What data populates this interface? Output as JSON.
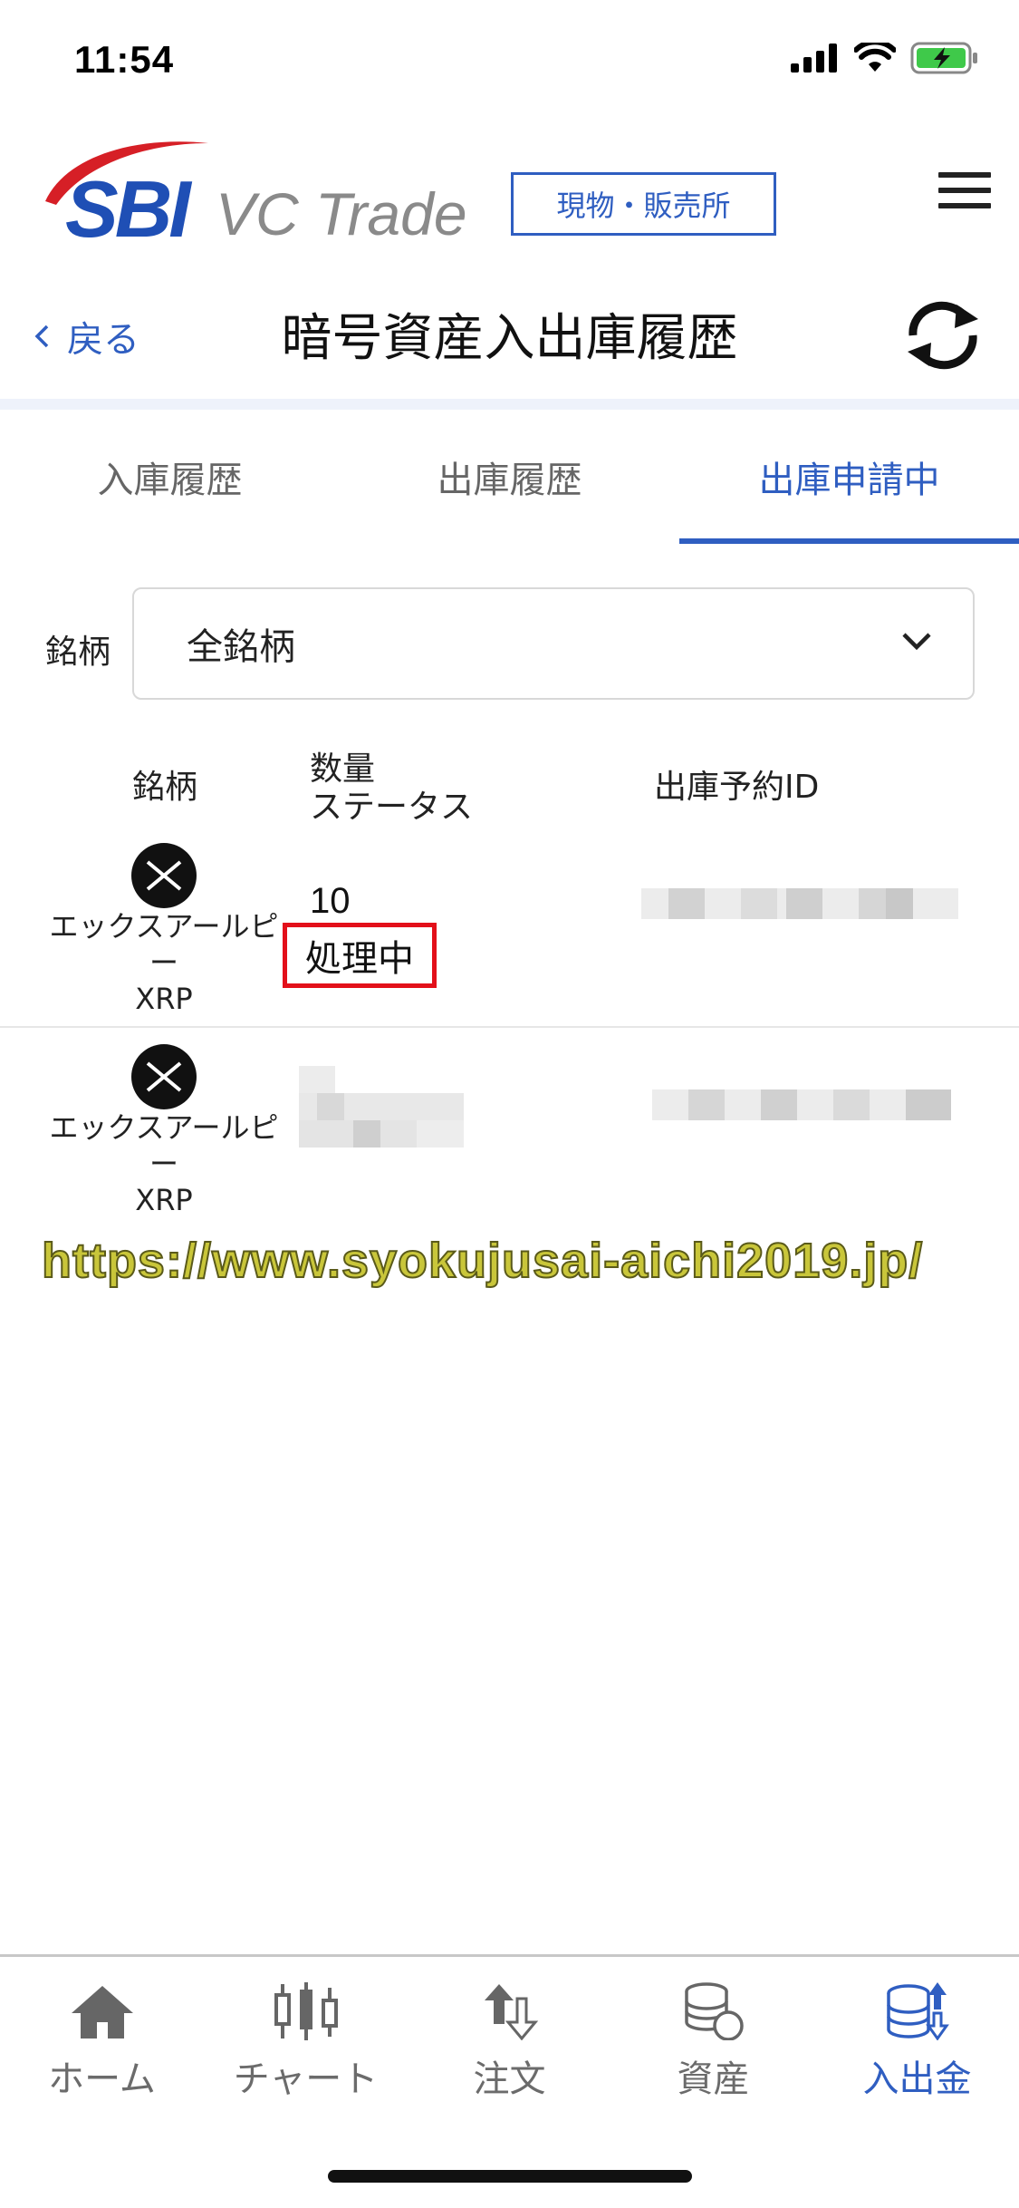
{
  "status_bar": {
    "time": "11:54"
  },
  "header": {
    "brand": "SBI",
    "brand_product": "VC Trade",
    "mode_badge": "現物・販売所"
  },
  "nav_bar": {
    "back_label": "戻る",
    "title": "暗号資産入出庫履歴"
  },
  "tabs": [
    {
      "label": "入庫履歴",
      "active": false
    },
    {
      "label": "出庫履歴",
      "active": false
    },
    {
      "label": "出庫申請中",
      "active": true
    }
  ],
  "filter": {
    "label": "銘柄",
    "selected": "全銘柄"
  },
  "table": {
    "headers": {
      "coin": "銘柄",
      "qty": "数量",
      "status": "ステータス",
      "id": "出庫予約ID"
    },
    "rows": [
      {
        "coin_name": "エックスアールピー",
        "coin_symbol": "XRP",
        "qty": "10",
        "status": "処理中"
      },
      {
        "coin_name": "エックスアールピー",
        "coin_symbol": "XRP",
        "qty": "",
        "status": ""
      }
    ]
  },
  "watermark": "https://www.syokujusai-aichi2019.jp/",
  "bottom_nav": [
    {
      "label": "ホーム",
      "icon": "home-icon",
      "active": false
    },
    {
      "label": "チャート",
      "icon": "candlestick-chart-icon",
      "active": false
    },
    {
      "label": "注文",
      "icon": "order-arrows-icon",
      "active": false
    },
    {
      "label": "資産",
      "icon": "coins-icon",
      "active": false
    },
    {
      "label": "入出金",
      "icon": "deposit-withdraw-icon",
      "active": true
    }
  ],
  "colors": {
    "accent": "#2f5ec1",
    "highlight_border": "#e3101a",
    "text": "#1a1a1a",
    "muted": "#6b6b6b"
  }
}
